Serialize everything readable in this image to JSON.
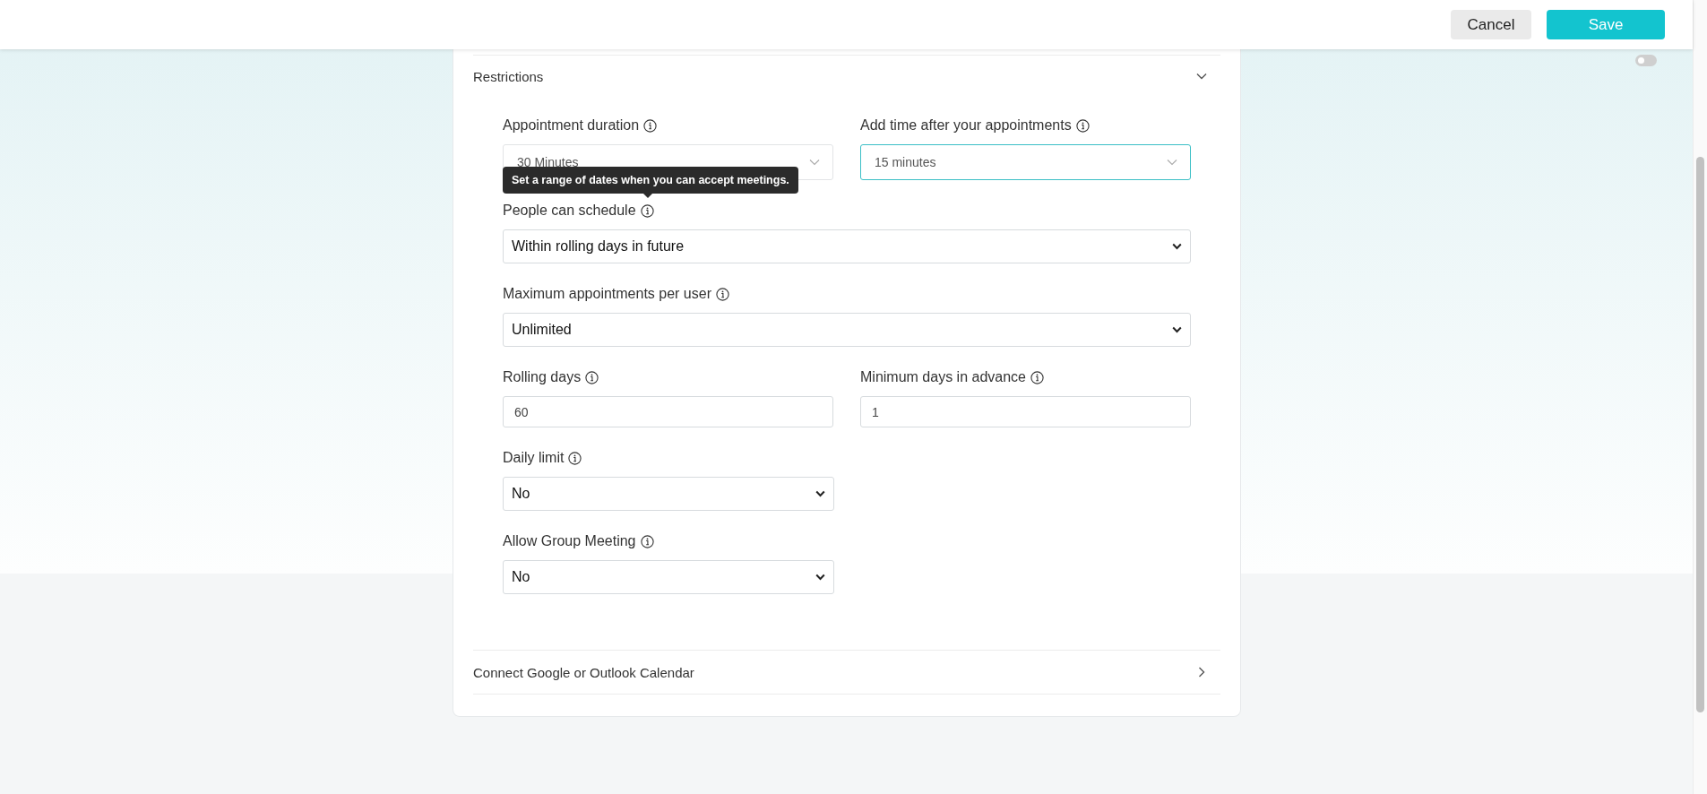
{
  "header": {
    "buttons": [
      {
        "label": "Cancel",
        "kind": "secondary"
      },
      {
        "label": "Save",
        "kind": "primary"
      }
    ]
  },
  "toggle": {
    "on": false
  },
  "restrictions": {
    "title": "Restrictions",
    "expanded": true,
    "rows": [
      [
        {
          "label": "Appointment duration",
          "kind": "dropdown",
          "value": "30 Minutes",
          "focused": false
        },
        {
          "label": "Add time after your appointments",
          "kind": "dropdown",
          "value": "15 minutes",
          "focused": true
        }
      ],
      [
        {
          "label": "People can schedule",
          "kind": "wide-select",
          "value": "Within rolling days in future",
          "tooltip": "Set a range of dates when you can accept meetings."
        }
      ],
      [
        {
          "label": "Maximum appointments per user",
          "kind": "wide-select",
          "value": "Unlimited"
        }
      ],
      [
        {
          "label": "Rolling days",
          "kind": "input",
          "value": "60"
        },
        {
          "label": "Minimum days in advance",
          "kind": "input",
          "value": "1"
        }
      ],
      [
        {
          "label": "Daily limit",
          "kind": "select",
          "value": "No"
        }
      ],
      [
        {
          "label": "Allow Group Meeting",
          "kind": "select",
          "value": "No"
        }
      ]
    ]
  },
  "calendar_section": {
    "title": "Connect Google or Outlook Calendar",
    "expanded": false
  }
}
